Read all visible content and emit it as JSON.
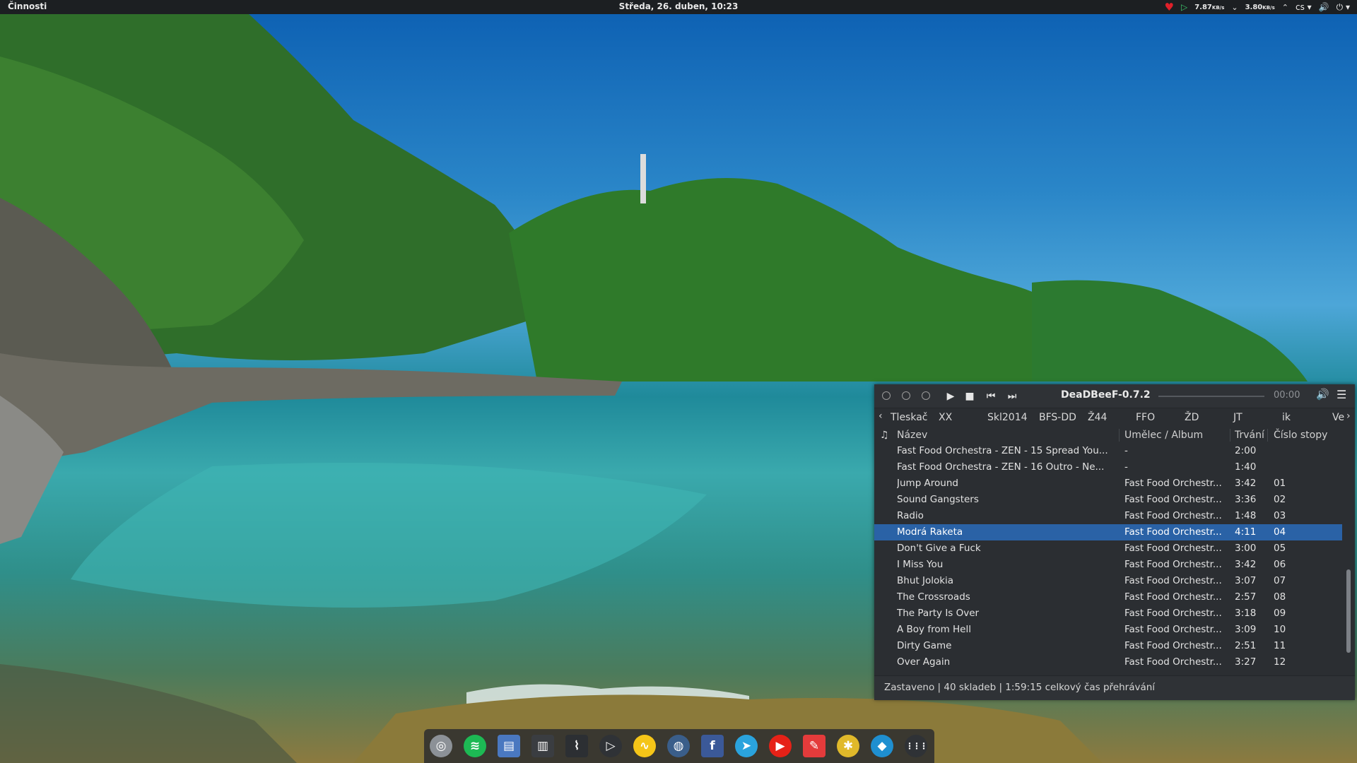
{
  "topbar": {
    "activities": "Činnosti",
    "clock": "Středa, 26. duben, 10:23",
    "net_down": "7.87",
    "net_down_unit": "KB/s",
    "net_up": "3.80",
    "net_up_unit": "KB/s",
    "keyboard_layout": "cs",
    "icons": [
      "heart-icon",
      "play-indicator-icon",
      "arrow-down-icon",
      "arrow-up-icon",
      "volume-icon",
      "power-icon"
    ]
  },
  "player": {
    "title": "DeaDBeeF-0.7.2",
    "time": "00:00",
    "controls": [
      "play-icon",
      "stop-icon",
      "previous-icon",
      "next-icon"
    ],
    "tabs": [
      "Tleskač",
      "XX",
      "Skl2014",
      "BFS-DD",
      "Ž44",
      "FFO",
      "ŽD",
      "JT",
      "ik",
      "Ve"
    ],
    "columns": {
      "title": "Název",
      "artist": "Umělec / Album",
      "duration": "Trvání",
      "track": "Číslo stopy"
    },
    "rows": [
      {
        "title": "Fast Food Orchestra - ZEN - 15 Spread You...",
        "artist": "-",
        "duration": "2:00",
        "track": ""
      },
      {
        "title": "Fast Food Orchestra - ZEN - 16 Outro - Ne...",
        "artist": "-",
        "duration": "1:40",
        "track": ""
      },
      {
        "title": "Jump Around",
        "artist": "Fast Food Orchestr...",
        "duration": "3:42",
        "track": "01"
      },
      {
        "title": "Sound Gangsters",
        "artist": "Fast Food Orchestr...",
        "duration": "3:36",
        "track": "02"
      },
      {
        "title": "Radio",
        "artist": "Fast Food Orchestr...",
        "duration": "1:48",
        "track": "03"
      },
      {
        "title": "Modrá Raketa",
        "artist": "Fast Food Orchestr...",
        "duration": "4:11",
        "track": "04",
        "selected": true
      },
      {
        "title": "Don't Give a Fuck",
        "artist": "Fast Food Orchestr...",
        "duration": "3:00",
        "track": "05"
      },
      {
        "title": "I Miss You",
        "artist": "Fast Food Orchestr...",
        "duration": "3:42",
        "track": "06"
      },
      {
        "title": "Bhut Jolokia",
        "artist": "Fast Food Orchestr...",
        "duration": "3:07",
        "track": "07"
      },
      {
        "title": "The Crossroads",
        "artist": "Fast Food Orchestr...",
        "duration": "2:57",
        "track": "08"
      },
      {
        "title": "The Party Is Over",
        "artist": "Fast Food Orchestr...",
        "duration": "3:18",
        "track": "09"
      },
      {
        "title": "A Boy from Hell",
        "artist": "Fast Food Orchestr...",
        "duration": "3:09",
        "track": "10"
      },
      {
        "title": "Dirty Game",
        "artist": "Fast Food Orchestr...",
        "duration": "2:51",
        "track": "11"
      },
      {
        "title": "Over Again",
        "artist": "Fast Food Orchestr...",
        "duration": "3:27",
        "track": "12"
      }
    ],
    "status": "Zastaveno | 40 skladeb | 1:59:15 celkový čas přehrávání"
  },
  "dock": {
    "apps": [
      {
        "name": "chrome-icon",
        "color": "#8c9197"
      },
      {
        "name": "spotify-icon",
        "color": "#1db954"
      },
      {
        "name": "files-icon",
        "color": "#4a78c0"
      },
      {
        "name": "file-manager-icon",
        "color": "#3a3d41"
      },
      {
        "name": "system-monitor-icon",
        "color": "#2c2f33"
      },
      {
        "name": "terminal-play-icon",
        "color": "#2f3236"
      },
      {
        "name": "pulse-icon",
        "color": "#f5c518"
      },
      {
        "name": "monitor-icon",
        "color": "#3a5e8a"
      },
      {
        "name": "facebook-icon",
        "color": "#3b5998"
      },
      {
        "name": "telegram-icon",
        "color": "#2aa3dd"
      },
      {
        "name": "youtube-icon",
        "color": "#e62117"
      },
      {
        "name": "pin-icon",
        "color": "#e43b3b"
      },
      {
        "name": "bug-icon",
        "color": "#e0b92a"
      },
      {
        "name": "kodi-icon",
        "color": "#1f8fd0"
      },
      {
        "name": "apps-grid-icon",
        "color": "#2f3236"
      }
    ]
  }
}
